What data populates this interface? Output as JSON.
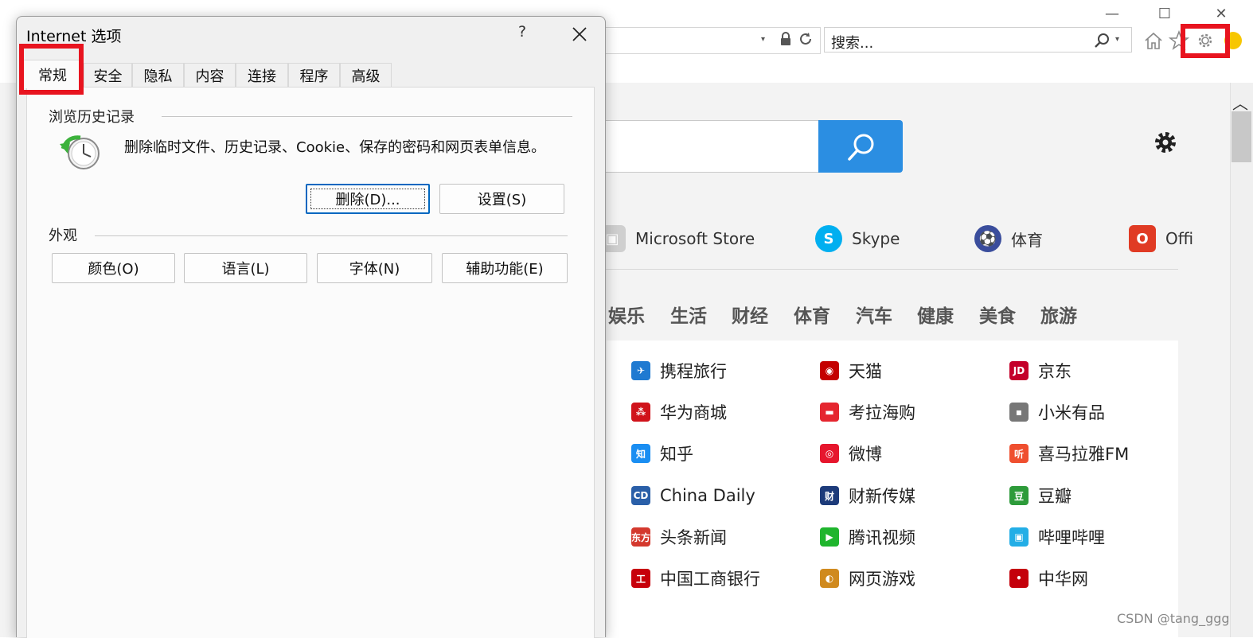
{
  "window_controls": {
    "minimize": "—",
    "maximize": "☐",
    "close": "✕"
  },
  "toolbar": {
    "search_placeholder": "搜索...",
    "address_dropdown": "▾",
    "search_dropdown": "▾"
  },
  "highlight_color": "#e8141f",
  "page": {
    "quick_links": [
      {
        "label": "Microsoft Store",
        "icon": "store-icon",
        "color": "#7cbb00"
      },
      {
        "label": "Skype",
        "icon": "skype-icon",
        "color": "#00aff0"
      },
      {
        "label": "体育",
        "icon": "soccer-icon",
        "color": "#3a4d9c"
      },
      {
        "label": "Offi",
        "icon": "office-icon",
        "color": "#e03b24"
      }
    ],
    "categories": [
      "娱乐",
      "生活",
      "财经",
      "体育",
      "汽车",
      "健康",
      "美食",
      "旅游"
    ],
    "links": [
      [
        "携程旅行",
        "天猫",
        "京东"
      ],
      [
        "华为商城",
        "考拉海购",
        "小米有品"
      ],
      [
        "知乎",
        "微博",
        "喜马拉雅FM"
      ],
      [
        "China Daily",
        "财新传媒",
        "豆瓣"
      ],
      [
        "头条新闻",
        "腾讯视频",
        "哔哩哔哩"
      ],
      [
        "中国工商银行",
        "网页游戏",
        "中华网"
      ]
    ],
    "link_icon_text": [
      [
        "✈",
        "◉",
        "JD"
      ],
      [
        "⁂",
        "▬",
        "▪"
      ],
      [
        "知",
        "◎",
        "听"
      ],
      [
        "CD",
        "财",
        "豆"
      ],
      [
        "东方",
        "▶",
        "▣"
      ],
      [
        "工",
        "◐",
        "•"
      ]
    ],
    "link_icon_colors": [
      [
        "#1f7ad1",
        "#c40000",
        "#c4002a"
      ],
      [
        "#d0131b",
        "#e5262f",
        "#777777"
      ],
      [
        "#1a8ef2",
        "#e6162d",
        "#ef4f2f"
      ],
      [
        "#2a5fa8",
        "#1d3b7a",
        "#2d9b3a"
      ],
      [
        "#d4392e",
        "#1fb52d",
        "#23aee6"
      ],
      [
        "#c7000b",
        "#d08a1e",
        "#c4000b"
      ]
    ],
    "watermark": "CSDN @tang_ggg"
  },
  "dialog": {
    "title": "Internet 选项",
    "help": "?",
    "tabs": [
      "常规",
      "安全",
      "隐私",
      "内容",
      "连接",
      "程序",
      "高级"
    ],
    "history_group": "浏览历史记录",
    "history_desc": "删除临时文件、历史记录、Cookie、保存的密码和网页表单信息。",
    "delete_button": "删除(D)...",
    "settings_button": "设置(S)",
    "appearance_group": "外观",
    "appearance_buttons": [
      "颜色(O)",
      "语言(L)",
      "字体(N)",
      "辅助功能(E)"
    ]
  }
}
